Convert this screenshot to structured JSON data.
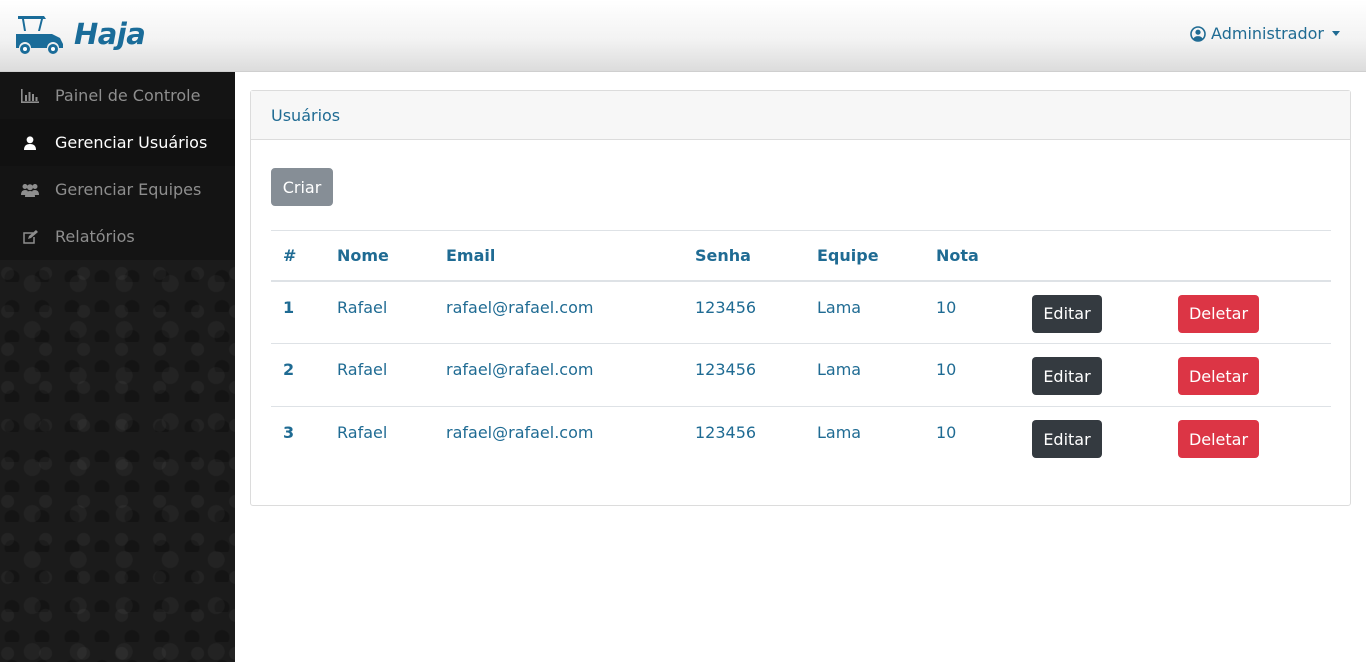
{
  "brand": {
    "name": "Haja"
  },
  "user_menu": {
    "label": "Administrador"
  },
  "sidebar": {
    "items": [
      {
        "label": "Painel de Controle",
        "icon": "bar-chart-icon",
        "active": false
      },
      {
        "label": "Gerenciar Usuários",
        "icon": "user-icon",
        "active": true
      },
      {
        "label": "Gerenciar Equipes",
        "icon": "users-icon",
        "active": false
      },
      {
        "label": "Relatórios",
        "icon": "edit-icon",
        "active": false
      }
    ]
  },
  "card": {
    "title": "Usuários",
    "create_label": "Criar"
  },
  "table": {
    "headers": [
      "#",
      "Nome",
      "Email",
      "Senha",
      "Equipe",
      "Nota"
    ],
    "rows": [
      {
        "id": "1",
        "name": "Rafael",
        "email": "rafael@rafael.com",
        "password": "123456",
        "team": "Lama",
        "grade": "10",
        "edit": "Editar",
        "delete": "Deletar"
      },
      {
        "id": "2",
        "name": "Rafael",
        "email": "rafael@rafael.com",
        "password": "123456",
        "team": "Lama",
        "grade": "10",
        "edit": "Editar",
        "delete": "Deletar"
      },
      {
        "id": "3",
        "name": "Rafael",
        "email": "rafael@rafael.com",
        "password": "123456",
        "team": "Lama",
        "grade": "10",
        "edit": "Editar",
        "delete": "Deletar"
      }
    ]
  },
  "colors": {
    "primary_text": "#1f6b93",
    "edit_button": "#343a40",
    "delete_button": "#dc3545",
    "create_button": "#868e96",
    "sidebar_bg": "#1b1b1b"
  }
}
